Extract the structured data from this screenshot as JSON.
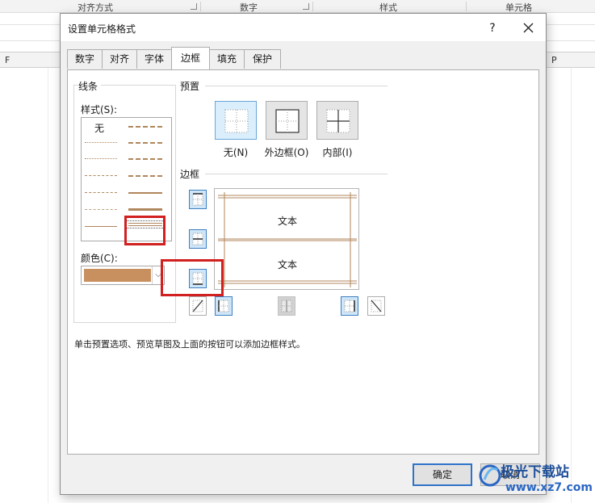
{
  "background": {
    "ribbon_groups": [
      "对齐方式",
      "数字",
      "样式",
      "单元格"
    ],
    "columns": [
      "F",
      "P"
    ]
  },
  "dialog": {
    "title": "设置单元格格式",
    "help_label": "?",
    "tabs": [
      {
        "label": "数字"
      },
      {
        "label": "对齐"
      },
      {
        "label": "字体"
      },
      {
        "label": "边框",
        "active": true
      },
      {
        "label": "填充"
      },
      {
        "label": "保护"
      }
    ],
    "line_section": {
      "group_label": "线条",
      "style_label": "样式(S):",
      "style_label_key": "S",
      "none_label": "无",
      "color_label": "颜色(C):",
      "color_label_key": "C",
      "color_value": "#c9905f"
    },
    "preset_section": {
      "group_label": "预置",
      "presets": [
        {
          "label": "无(N)",
          "key": "N"
        },
        {
          "label": "外边框(O)",
          "key": "O"
        },
        {
          "label": "内部(I)",
          "key": "I"
        }
      ]
    },
    "border_section": {
      "group_label": "边框",
      "preview_text_top": "文本",
      "preview_text_bottom": "文本"
    },
    "info_text": "单击预置选项、预览草图及上面的按钮可以添加边框样式。",
    "ok_label": "确定",
    "cancel_label": "取消"
  },
  "colors": {
    "border_line": "#c9905f",
    "highlight": "#d21f1f",
    "accent": "#2f73c9"
  },
  "watermark": {
    "text": "极光下载站",
    "url": "www.xz7.com"
  }
}
